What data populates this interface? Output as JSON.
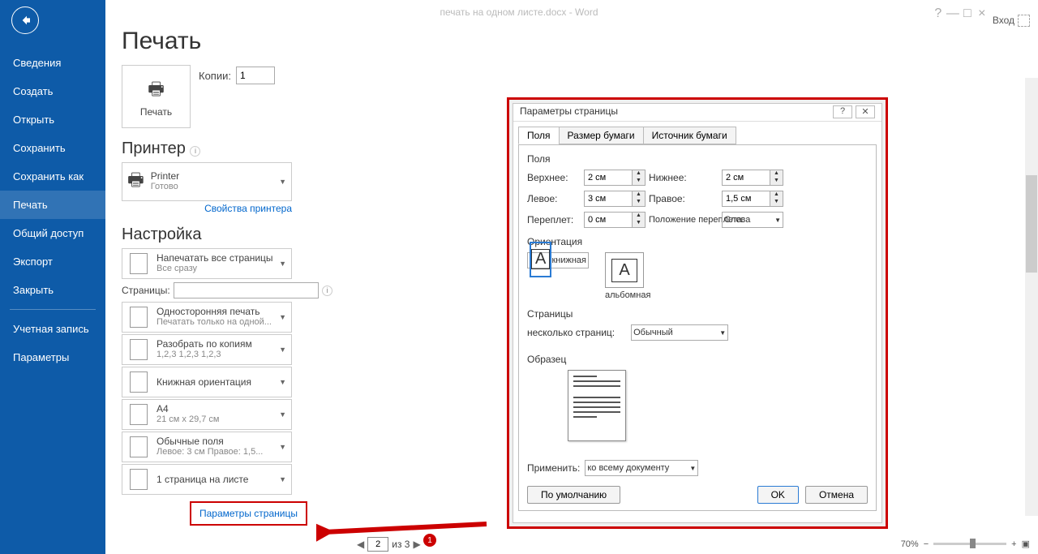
{
  "window": {
    "title": "печать на одном листе.docx - Word",
    "login": "Вход"
  },
  "sidebar": {
    "items": [
      {
        "label": "Сведения"
      },
      {
        "label": "Создать"
      },
      {
        "label": "Открыть"
      },
      {
        "label": "Сохранить"
      },
      {
        "label": "Сохранить как"
      },
      {
        "label": "Печать"
      },
      {
        "label": "Общий доступ"
      },
      {
        "label": "Экспорт"
      },
      {
        "label": "Закрыть"
      }
    ],
    "footer": [
      {
        "label": "Учетная запись"
      },
      {
        "label": "Параметры"
      }
    ]
  },
  "print": {
    "title": "Печать",
    "button": "Печать",
    "copies_label": "Копии:",
    "copies_value": "1",
    "printer_section": "Принтер",
    "printer_name": "Printer",
    "printer_status": "Готово",
    "printer_props": "Свойства принтера",
    "settings_section": "Настройка",
    "all_pages": "Напечатать все страницы",
    "all_pages_sub": "Все сразу",
    "pages_label": "Страницы:",
    "oneside": "Односторонняя печать",
    "oneside_sub": "Печатать только на одной...",
    "collate": "Разобрать по копиям",
    "collate_sub": "1,2,3    1,2,3    1,2,3",
    "orientation": "Книжная ориентация",
    "paper": "A4",
    "paper_sub": "21 см x 29,7 см",
    "margins": "Обычные поля",
    "margins_sub": "Левое: 3 см   Правое: 1,5...",
    "perpage": "1 страница на листе",
    "page_setup_link": "Параметры страницы",
    "badge": "1"
  },
  "preview": {
    "current": "2",
    "total": "из 3",
    "zoom": "70%"
  },
  "dialog": {
    "title": "Параметры страницы",
    "tabs": [
      "Поля",
      "Размер бумаги",
      "Источник бумаги"
    ],
    "group_margins": "Поля",
    "top": "Верхнее:",
    "top_v": "2 см",
    "bottom": "Нижнее:",
    "bottom_v": "2 см",
    "left": "Левое:",
    "left_v": "3 см",
    "right": "Правое:",
    "right_v": "1,5 см",
    "gutter": "Переплет:",
    "gutter_v": "0 см",
    "gutter_pos": "Положение переплета:",
    "gutter_pos_v": "Слева",
    "group_orient": "Ориентация",
    "portrait": "книжная",
    "landscape": "альбомная",
    "group_pages": "Страницы",
    "multipages": "несколько страниц:",
    "multipages_v": "Обычный",
    "group_sample": "Образец",
    "apply": "Применить:",
    "apply_v": "ко всему документу",
    "default_btn": "По умолчанию",
    "ok": "OK",
    "cancel": "Отмена"
  }
}
